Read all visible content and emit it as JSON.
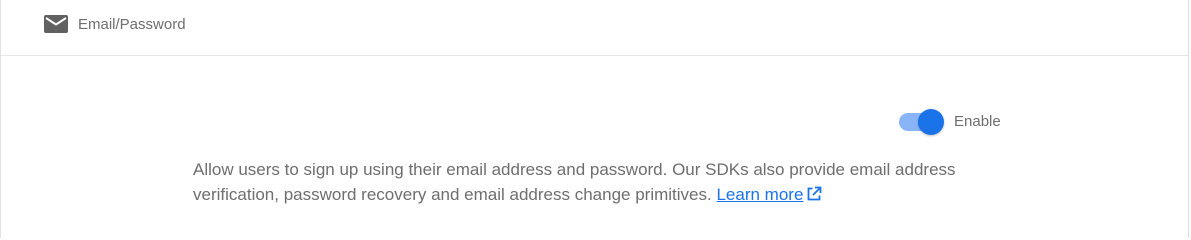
{
  "header": {
    "icon": "mail-icon",
    "title": "Email/Password"
  },
  "provider": {
    "enabled": true,
    "toggle_label": "Enable",
    "description": "Allow users to sign up using their email address and password. Our SDKs also provide email address verification, password recovery and email address change primitives.",
    "learn_more_label": "Learn more",
    "learn_more_icon": "open-in-new-icon"
  },
  "colors": {
    "accent": "#1a73e8",
    "track_on": "#8ab4f8",
    "text_secondary": "#6e6e6e"
  }
}
